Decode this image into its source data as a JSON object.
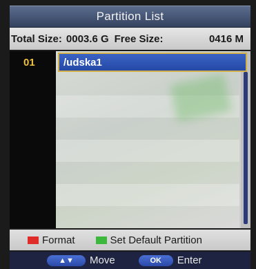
{
  "title": "Partition List",
  "info": {
    "total_label": "Total Size:",
    "total_value": "0003.6 G",
    "free_label": "Free Size:",
    "free_value": "0416 M"
  },
  "partitions": [
    {
      "number": "01",
      "name": "/udska1",
      "selected": true
    }
  ],
  "legend": {
    "format_label": "Format",
    "default_label": "Set Default Partition",
    "format_color": "#e02b2b",
    "default_color": "#3cb93c"
  },
  "nav": {
    "move_key": "▲▼",
    "move_label": "Move",
    "ok_key": "OK",
    "ok_label": "Enter"
  },
  "colors": {
    "title_bg": "#34425f",
    "selection_bg": "#2448a6",
    "selection_border": "#d4b04a",
    "number_color": "#f0c040"
  }
}
